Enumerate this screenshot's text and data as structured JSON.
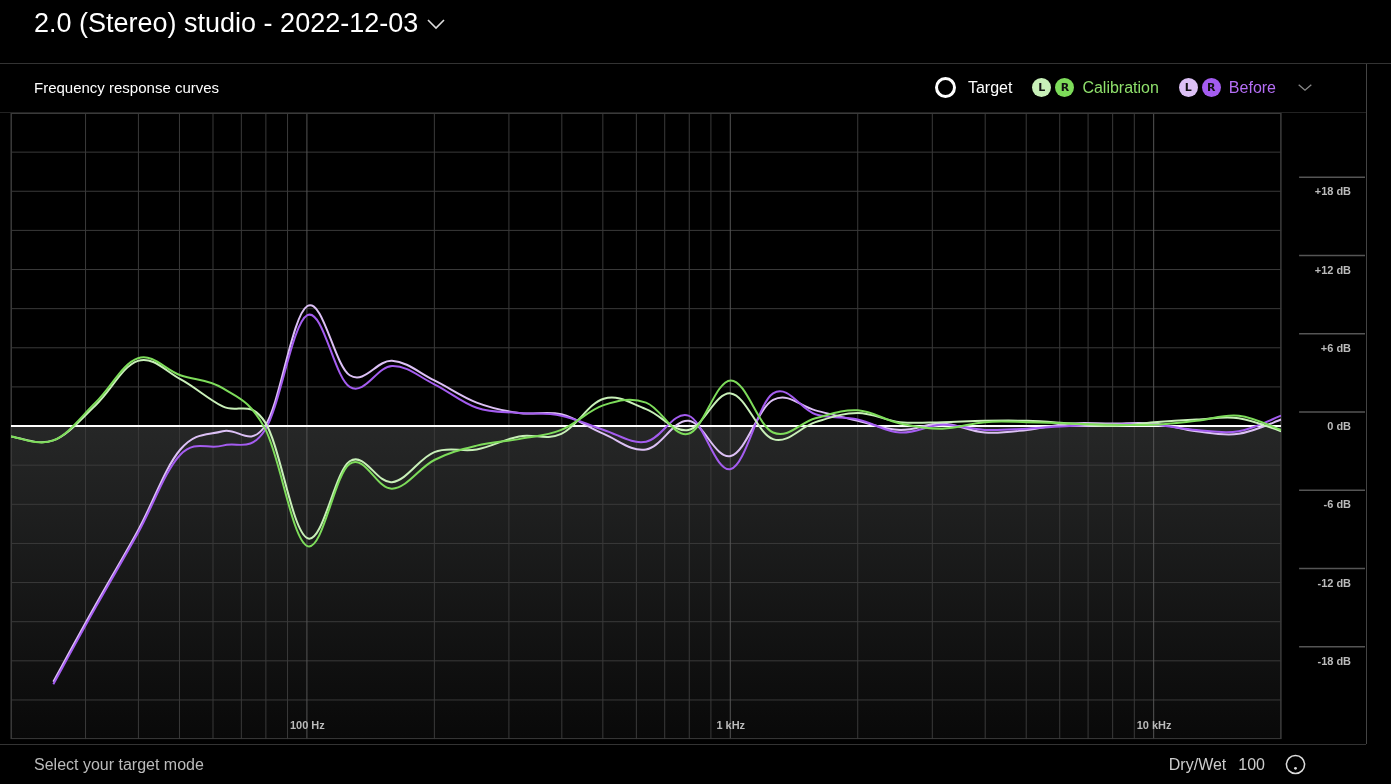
{
  "header": {
    "title": "2.0 (Stereo) studio - 2022-12-03"
  },
  "panel": {
    "title": "Frequency response curves",
    "legend": [
      {
        "kind": "single",
        "label": "Target",
        "color": "#ffffff"
      },
      {
        "kind": "pair",
        "label": "Calibration",
        "color": "#8fe06c",
        "channels": [
          {
            "label": "L",
            "color": "#c8f0b8"
          },
          {
            "label": "R",
            "color": "#7ddc5a"
          }
        ]
      },
      {
        "kind": "pair",
        "label": "Before",
        "color": "#b46ef5",
        "channels": [
          {
            "label": "L",
            "color": "#dcc0f5"
          },
          {
            "label": "R",
            "color": "#a45cf0"
          }
        ]
      }
    ],
    "chart_data": {
      "type": "line",
      "categories": [
        null,
        null,
        null,
        null,
        null,
        null,
        null,
        "100 Hz",
        null,
        null,
        null,
        null,
        null,
        null,
        null,
        null,
        null,
        "1 kHz",
        null,
        null,
        null,
        null,
        null,
        null,
        null,
        null,
        null,
        "10 kHz",
        null,
        null,
        null
      ],
      "ylim": [
        -24,
        24
      ],
      "grid": true,
      "yticks": [
        {
          "value": 18,
          "label": "+18 dB"
        },
        {
          "value": 12,
          "label": "+12 dB"
        },
        {
          "value": 6,
          "label": "+6 dB"
        },
        {
          "value": 0,
          "label": "0 dB"
        },
        {
          "value": -6,
          "label": "-6 dB"
        },
        {
          "value": -12,
          "label": "-12 dB"
        },
        {
          "value": -18,
          "label": "-18 dB"
        }
      ],
      "series": [
        {
          "color": "#ffffff",
          "values": [
            0,
            0,
            0,
            0,
            0,
            0,
            0,
            0,
            0,
            0,
            0,
            0,
            0,
            0,
            0,
            0,
            0,
            0,
            0,
            0,
            0,
            0,
            0,
            0,
            0,
            0,
            0,
            0,
            0,
            0,
            0
          ]
        },
        {
          "color": "#dcc0f5",
          "values": [
            null,
            -19.6,
            -13.7,
            -8.0,
            -1.8,
            -0.4,
            0,
            9.2,
            3.9,
            5.0,
            3.5,
            1.8,
            1.0,
            0.9,
            -0.6,
            -1.8,
            0.4,
            -2.3,
            2.0,
            1.2,
            0.4,
            -0.3,
            0.2,
            -0.5,
            -0.3,
            0.2,
            0.2,
            0.2,
            -0.4,
            -0.6,
            0.5
          ]
        },
        {
          "color": "#a45cf0",
          "values": [
            null,
            -19.8,
            -13.9,
            -8.2,
            -2.2,
            -1.5,
            -0.3,
            8.5,
            3.0,
            4.6,
            3.2,
            1.4,
            1.0,
            0.8,
            -0.3,
            -1.2,
            0.8,
            -3.3,
            2.5,
            0.9,
            0.5,
            -0.5,
            0.1,
            -0.3,
            -0.2,
            0,
            0.1,
            0.1,
            -0.3,
            -0.4,
            0.8
          ]
        },
        {
          "color": "#c8f0b8",
          "values": [
            -0.8,
            -1.1,
            1.6,
            5.0,
            3.6,
            1.5,
            0.3,
            -8.6,
            -2.7,
            -4.3,
            -2.0,
            -1.8,
            -0.8,
            -0.6,
            2.1,
            1.3,
            -0.3,
            2.5,
            -1.0,
            0.3,
            1.0,
            0.3,
            0.3,
            0.4,
            0.4,
            0.2,
            0,
            0.3,
            0.5,
            0.6,
            -0.4
          ]
        },
        {
          "color": "#7ddc5a",
          "values": [
            -0.8,
            -1.1,
            1.8,
            5.2,
            3.9,
            2.9,
            -0.2,
            -9.2,
            -2.9,
            -4.8,
            -2.6,
            -1.5,
            -1.0,
            -0.3,
            1.6,
            1.8,
            -0.6,
            3.5,
            -0.5,
            0.6,
            1.2,
            0.2,
            -0.2,
            0.3,
            0.3,
            0.2,
            0.1,
            0.1,
            0.4,
            0.8,
            -0.3
          ]
        }
      ]
    }
  },
  "footer": {
    "status": "Select your target mode",
    "mix_label": "Dry/Wet",
    "mix_value": "100"
  }
}
